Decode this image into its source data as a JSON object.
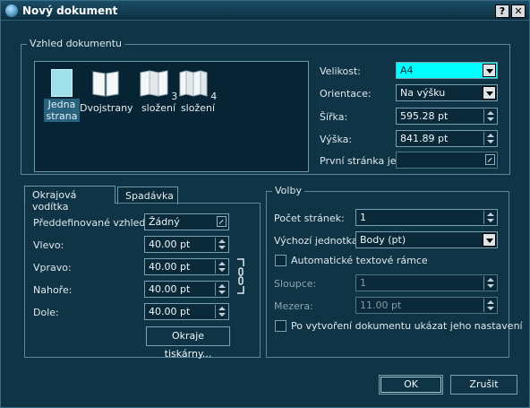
{
  "window": {
    "title": "Nový dokument",
    "help_label": "?",
    "close_label": "✕"
  },
  "doc_group": {
    "title": "Vzhled dokumentu",
    "layouts": [
      {
        "line1": "Jedna",
        "line2": "strana"
      },
      {
        "line1": "Dvojstrany",
        "line2": ""
      },
      {
        "line1": "3",
        "line2": "složení"
      },
      {
        "line1": "4",
        "line2": "složení"
      }
    ],
    "size_label": "Velikost:",
    "size_value": "A4",
    "orient_label": "Orientace:",
    "orient_value": "Na výšku",
    "width_label": "Šířka:",
    "width_value": "595.28 pt",
    "height_label": "Výška:",
    "height_value": "841.89 pt",
    "first_page_label": "První stránka je:",
    "first_page_value": ""
  },
  "tabs": {
    "margins": "Okrajová vodítka",
    "bleed": "Spadávka"
  },
  "margins": {
    "preset_label": "Předdefinované vzhledy:",
    "preset_value": "Žádný",
    "left_label": "Vlevo:",
    "left_value": "40.00 pt",
    "right_label": "Vpravo:",
    "right_value": "40.00 pt",
    "top_label": "Nahoře:",
    "top_value": "40.00 pt",
    "bottom_label": "Dole:",
    "bottom_value": "40.00 pt",
    "printer_button": "Okraje tiskárny..."
  },
  "options": {
    "title": "Volby",
    "pages_label": "Počet stránek:",
    "pages_value": "1",
    "unit_label": "Výchozí jednotka:",
    "unit_value": "Body (pt)",
    "auto_frames_label": "Automatické textové rámce",
    "columns_label": "Sloupce:",
    "columns_value": "1",
    "gap_label": "Mezera:",
    "gap_value": "11.00 pt",
    "show_settings_label": "Po vytvoření dokumentu ukázat jeho nastavení"
  },
  "buttons": {
    "ok": "OK",
    "cancel": "Zrušit"
  }
}
